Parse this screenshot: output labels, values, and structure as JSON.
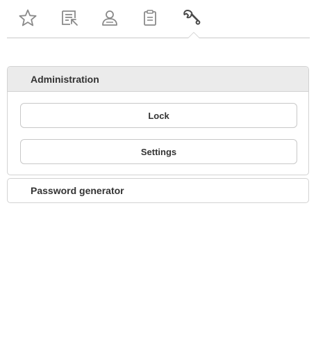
{
  "toolbar": {
    "tabs": [
      {
        "icon": "star-icon",
        "label": ""
      },
      {
        "icon": "list-icon",
        "label": ""
      },
      {
        "icon": "user-icon",
        "label": ""
      },
      {
        "icon": "clipboard-icon",
        "label": ""
      },
      {
        "icon": "wrench-icon",
        "label": ""
      }
    ],
    "active_tab": "wrench-icon"
  },
  "administration": {
    "title": "Administration",
    "lock_label": "Lock",
    "settings_label": "Settings"
  },
  "password_generator": {
    "title": "Password generator"
  },
  "colors": {
    "icon": "#8a8a8a",
    "active_icon": "#4a4a4a",
    "header_bg": "#ebebeb",
    "border": "#d2d2d2"
  }
}
